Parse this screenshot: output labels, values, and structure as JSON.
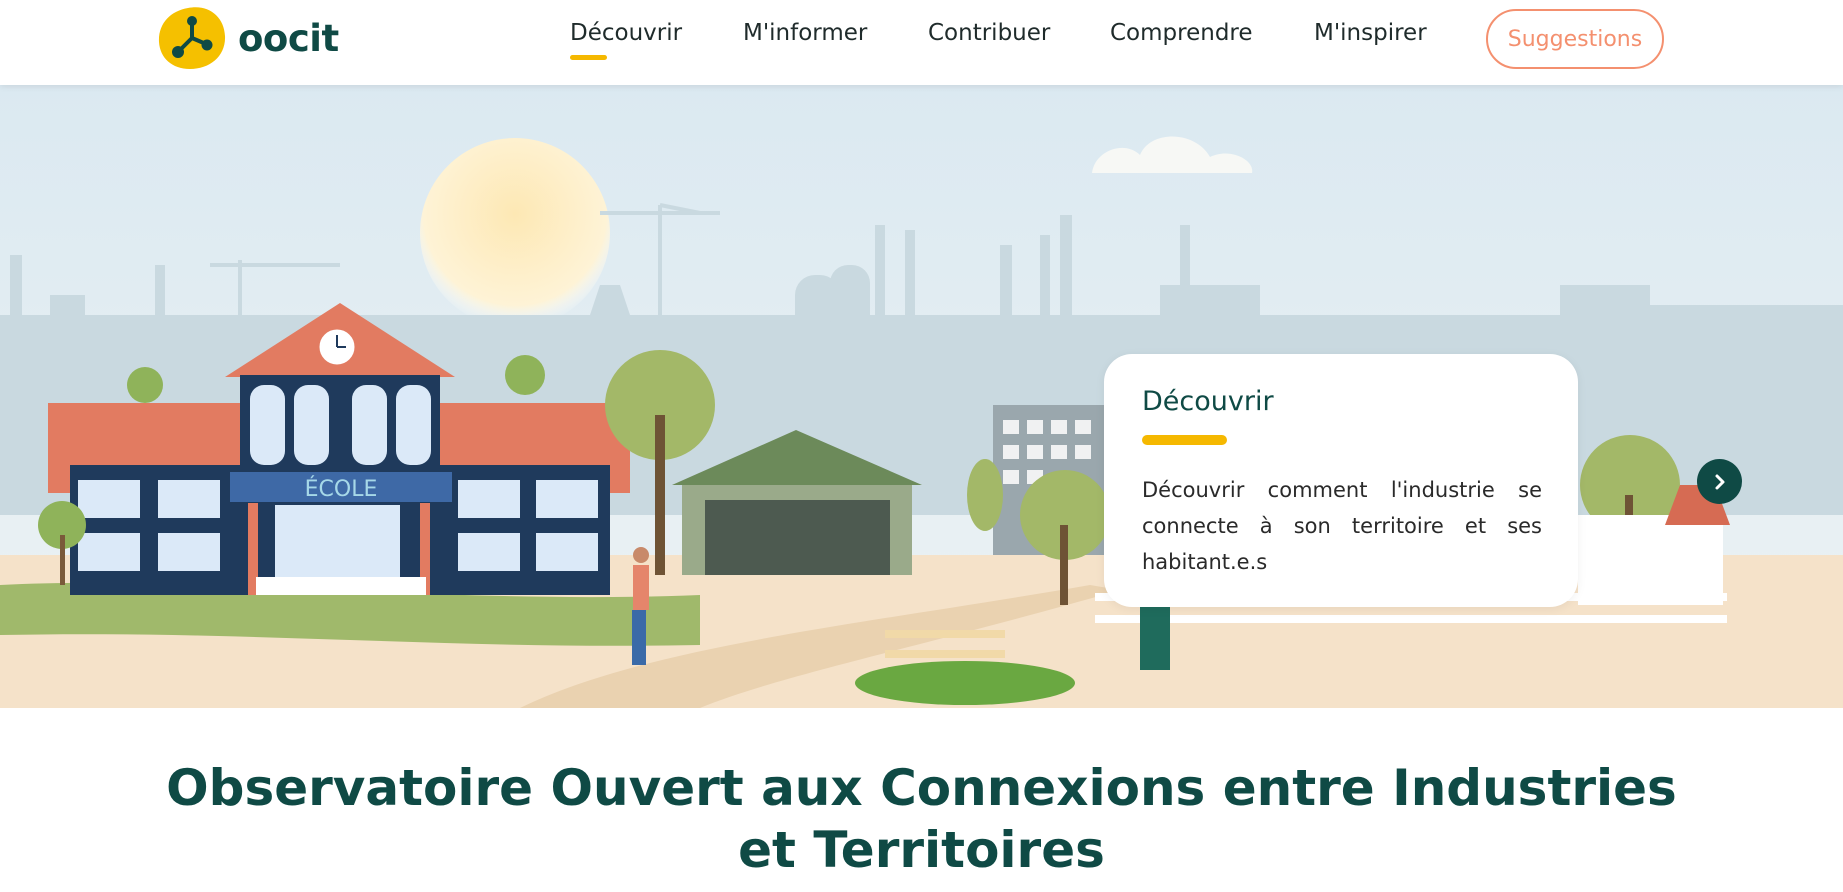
{
  "brand": {
    "name": "oocit",
    "logo_icon": "molecule-logo-icon",
    "accent": "#f5b800",
    "primary": "#0f4a45",
    "secondary": "#f4906f"
  },
  "nav": {
    "items": [
      {
        "label": "Découvrir",
        "active": true
      },
      {
        "label": "M'informer",
        "active": false
      },
      {
        "label": "Contribuer",
        "active": false
      },
      {
        "label": "Comprendre",
        "active": false
      },
      {
        "label": "M'inspirer",
        "active": false
      }
    ],
    "suggestions_label": "Suggestions"
  },
  "hero": {
    "illustration_label": "ÉCOLE",
    "card": {
      "title": "Découvrir",
      "text": "Découvrir comment l'industrie se connecte à son territoire et ses habitant.e.s"
    },
    "next_icon": "chevron-right-icon"
  },
  "main": {
    "title": "Observatoire Ouvert aux Connexions entre Industries et Territoires"
  }
}
